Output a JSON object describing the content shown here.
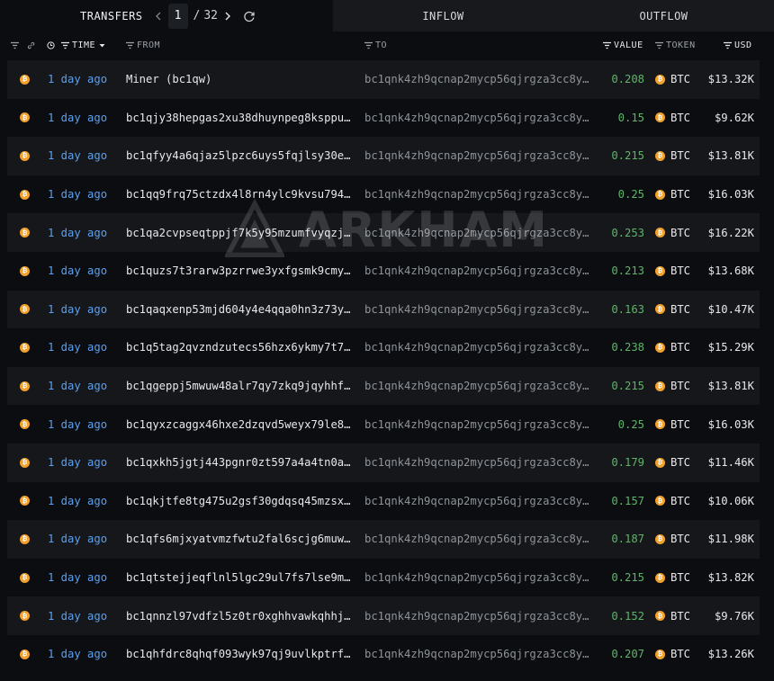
{
  "tabs": {
    "transfers": "TRANSFERS",
    "inflow": "INFLOW",
    "outflow": "OUTFLOW"
  },
  "pager": {
    "current": "1",
    "separator": "/",
    "total": "32"
  },
  "columns": {
    "time": "TIME",
    "from": "FROM",
    "to": "TO",
    "value": "VALUE",
    "token": "TOKEN",
    "usd": "USD"
  },
  "watermark": "ARKHAM",
  "rows": [
    {
      "time": "1 day ago",
      "from": "Miner (bc1qw)",
      "to": "bc1qnk4zh9qcnap2mycp56qjrgza3cc8y…",
      "value": "0.208",
      "token": "BTC",
      "usd": "$13.32K"
    },
    {
      "time": "1 day ago",
      "from": "bc1qjy38hepgas2xu38dhuynpeg8ksppu…",
      "to": "bc1qnk4zh9qcnap2mycp56qjrgza3cc8y…",
      "value": "0.15",
      "token": "BTC",
      "usd": "$9.62K"
    },
    {
      "time": "1 day ago",
      "from": "bc1qfyy4a6qjaz5lpzc6uys5fqjlsy30e…",
      "to": "bc1qnk4zh9qcnap2mycp56qjrgza3cc8y…",
      "value": "0.215",
      "token": "BTC",
      "usd": "$13.81K"
    },
    {
      "time": "1 day ago",
      "from": "bc1qq9frq75ctzdx4l8rn4ylc9kvsu794…",
      "to": "bc1qnk4zh9qcnap2mycp56qjrgza3cc8y…",
      "value": "0.25",
      "token": "BTC",
      "usd": "$16.03K"
    },
    {
      "time": "1 day ago",
      "from": "bc1qa2cvpseqtppjf7k5y95mzumfvyqzj…",
      "to": "bc1qnk4zh9qcnap2mycp56qjrgza3cc8y…",
      "value": "0.253",
      "token": "BTC",
      "usd": "$16.22K"
    },
    {
      "time": "1 day ago",
      "from": "bc1quzs7t3rarw3pzrrwe3yxfgsmk9cmy…",
      "to": "bc1qnk4zh9qcnap2mycp56qjrgza3cc8y…",
      "value": "0.213",
      "token": "BTC",
      "usd": "$13.68K"
    },
    {
      "time": "1 day ago",
      "from": "bc1qaqxenp53mjd604y4e4qqa0hn3z73y…",
      "to": "bc1qnk4zh9qcnap2mycp56qjrgza3cc8y…",
      "value": "0.163",
      "token": "BTC",
      "usd": "$10.47K"
    },
    {
      "time": "1 day ago",
      "from": "bc1q5tag2qvzndzutecs56hzx6ykmy7t7…",
      "to": "bc1qnk4zh9qcnap2mycp56qjrgza3cc8y…",
      "value": "0.238",
      "token": "BTC",
      "usd": "$15.29K"
    },
    {
      "time": "1 day ago",
      "from": "bc1qgeppj5mwuw48alr7qy7zkq9jqyhhf…",
      "to": "bc1qnk4zh9qcnap2mycp56qjrgza3cc8y…",
      "value": "0.215",
      "token": "BTC",
      "usd": "$13.81K"
    },
    {
      "time": "1 day ago",
      "from": "bc1qyxzcaggx46hxe2dzqvd5weyx79le8…",
      "to": "bc1qnk4zh9qcnap2mycp56qjrgza3cc8y…",
      "value": "0.25",
      "token": "BTC",
      "usd": "$16.03K"
    },
    {
      "time": "1 day ago",
      "from": "bc1qxkh5jgtj443pgnr0zt597a4a4tn0a…",
      "to": "bc1qnk4zh9qcnap2mycp56qjrgza3cc8y…",
      "value": "0.179",
      "token": "BTC",
      "usd": "$11.46K"
    },
    {
      "time": "1 day ago",
      "from": "bc1qkjtfe8tg475u2gsf30gdqsq45mzsx…",
      "to": "bc1qnk4zh9qcnap2mycp56qjrgza3cc8y…",
      "value": "0.157",
      "token": "BTC",
      "usd": "$10.06K"
    },
    {
      "time": "1 day ago",
      "from": "bc1qfs6mjxyatvmzfwtu2fal6scjg6muw…",
      "to": "bc1qnk4zh9qcnap2mycp56qjrgza3cc8y…",
      "value": "0.187",
      "token": "BTC",
      "usd": "$11.98K"
    },
    {
      "time": "1 day ago",
      "from": "bc1qtstejjeqflnl5lgc29ul7fs7lse9m…",
      "to": "bc1qnk4zh9qcnap2mycp56qjrgza3cc8y…",
      "value": "0.215",
      "token": "BTC",
      "usd": "$13.82K"
    },
    {
      "time": "1 day ago",
      "from": "bc1qnnzl97vdfzl5z0tr0xghhvawkqhhj…",
      "to": "bc1qnk4zh9qcnap2mycp56qjrgza3cc8y…",
      "value": "0.152",
      "token": "BTC",
      "usd": "$9.76K"
    },
    {
      "time": "1 day ago",
      "from": "bc1qhfdrc8qhqf093wyk97qj9uvlkptrf…",
      "to": "bc1qnk4zh9qcnap2mycp56qjrgza3cc8y…",
      "value": "0.207",
      "token": "BTC",
      "usd": "$13.26K"
    }
  ]
}
